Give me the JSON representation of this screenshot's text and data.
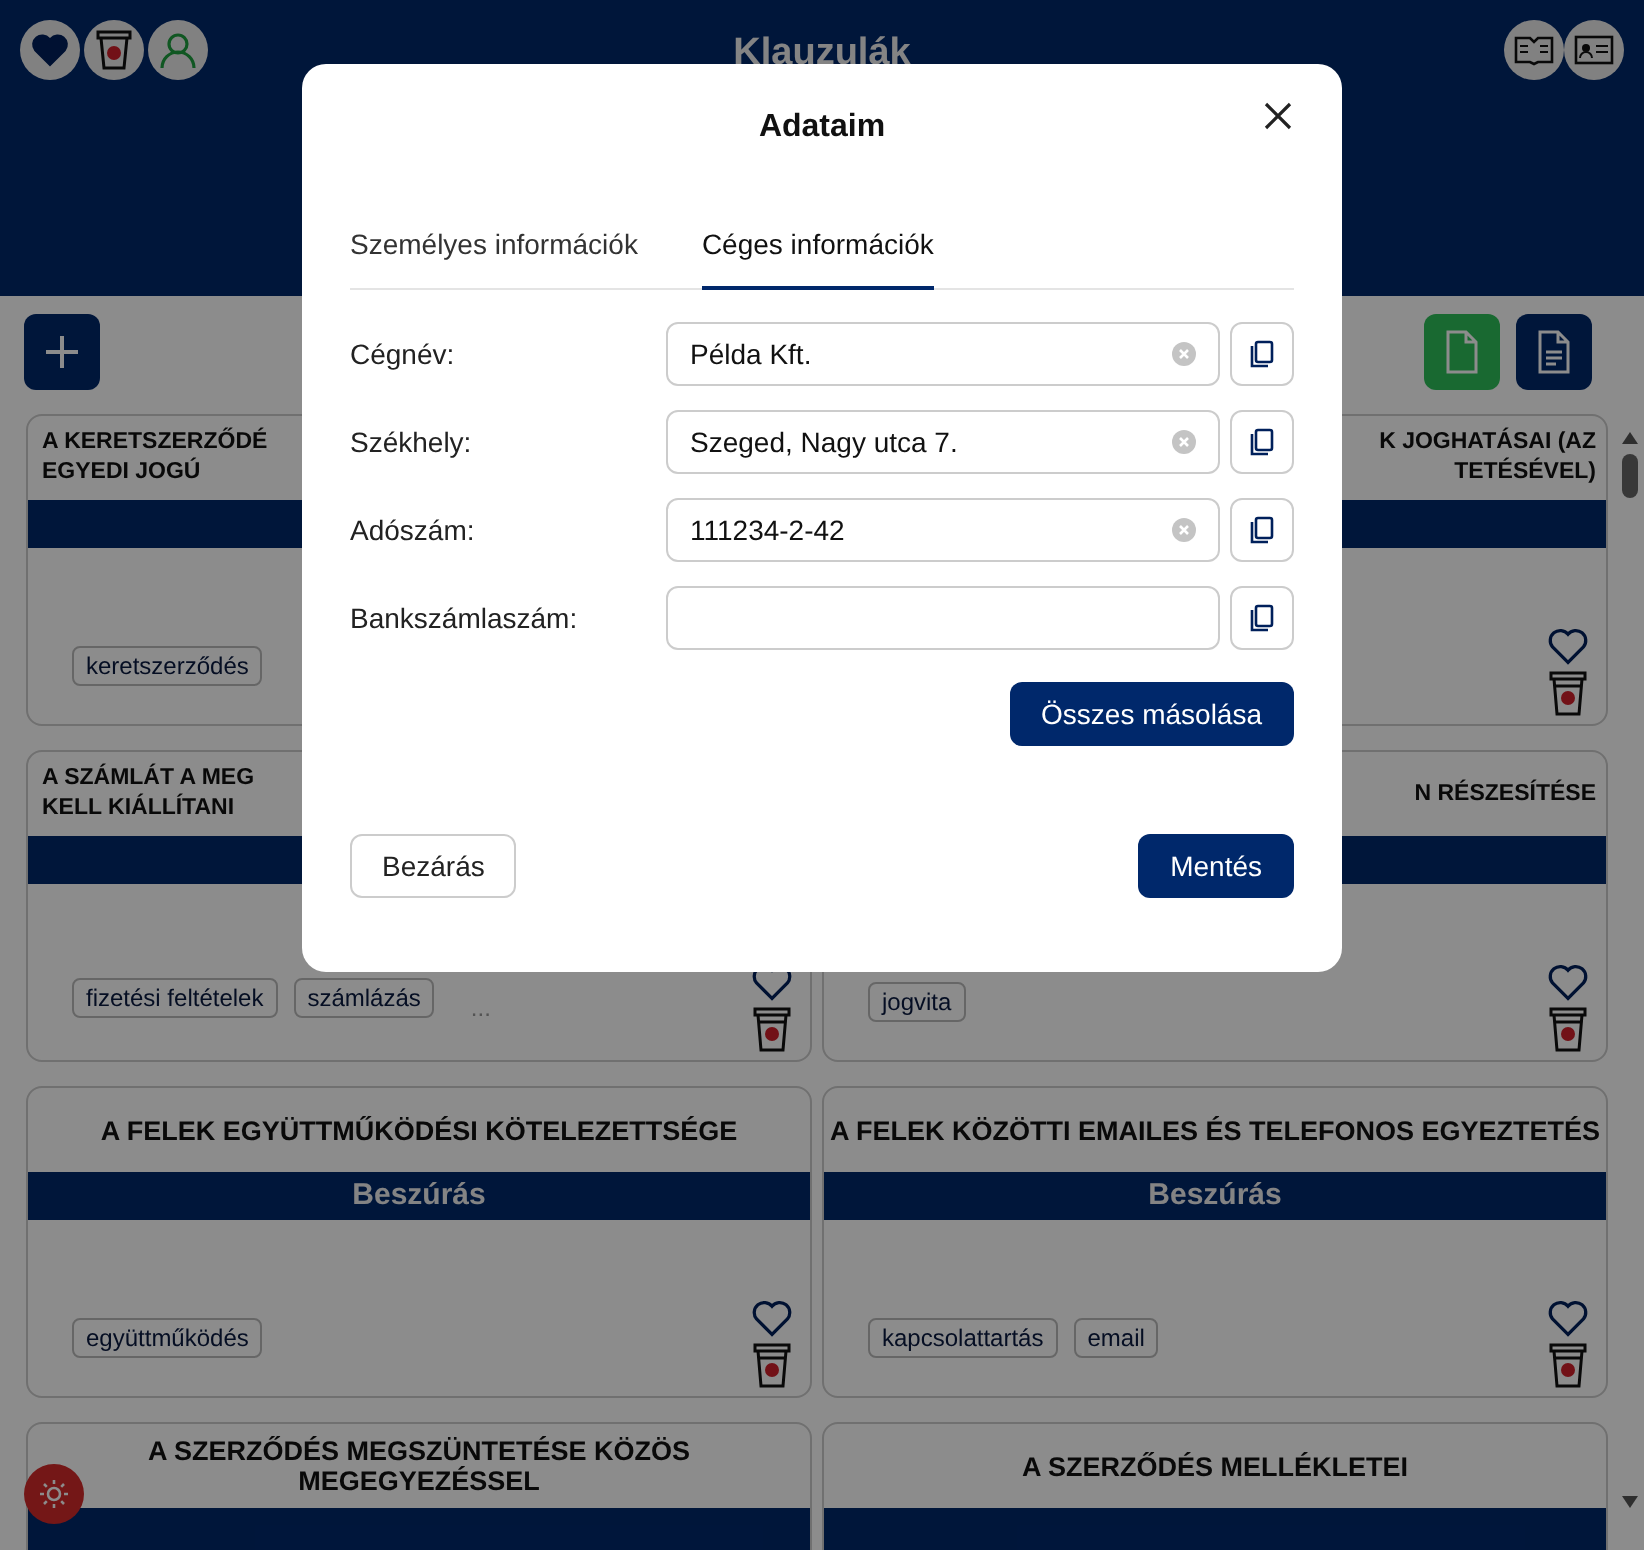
{
  "header": {
    "title": "Klauzulák"
  },
  "cards": [
    {
      "kind": "partial",
      "title_lines": [
        "A KERETSZERZŐDÉ",
        "EGYEDI JOGÚ"
      ],
      "tags": [
        "keretszerződés"
      ]
    },
    {
      "kind": "partial",
      "title_lines": [
        "K JOGHATÁSAI (AZ",
        "TETÉSÉVEL)"
      ]
    },
    {
      "kind": "partial",
      "title_lines": [
        "A SZÁMLÁT A MEG",
        "KELL KIÁLLÍTANI"
      ],
      "tags": [
        "fizetési feltételek",
        "számlázás"
      ],
      "more": "..."
    },
    {
      "kind": "partial",
      "title_lines": [
        "N RÉSZESÍTÉSE"
      ],
      "tags": [
        "jogvita"
      ]
    },
    {
      "kind": "full",
      "title_lines": [
        "A FELEK EGYÜTTMŰKÖDÉSI KÖTELEZETTSÉGE"
      ],
      "insert_label": "Beszúrás",
      "tags": [
        "együttműködés"
      ]
    },
    {
      "kind": "full",
      "title_lines": [
        "A FELEK KÖZÖTTI EMAILES ÉS TELEFONOS EGYEZTETÉS"
      ],
      "insert_label": "Beszúrás",
      "tags": [
        "kapcsolattartás",
        "email"
      ]
    },
    {
      "kind": "full",
      "title_lines": [
        "A SZERZŐDÉS MEGSZÜNTETÉSE KÖZÖS",
        "MEGEGYEZÉSSEL"
      ]
    },
    {
      "kind": "full",
      "title_lines": [
        "A SZERZŐDÉS MELLÉKLETEI"
      ]
    }
  ],
  "modal": {
    "title": "Adataim",
    "tabs": [
      {
        "label": "Személyes információk",
        "selected": false
      },
      {
        "label": "Céges információk",
        "selected": true
      }
    ],
    "fields": [
      {
        "label": "Cégnév:",
        "value": "Példa Kft."
      },
      {
        "label": "Székhely:",
        "value": "Szeged, Nagy utca 7."
      },
      {
        "label": "Adószám:",
        "value": "111234-2-42"
      },
      {
        "label": "Bankszámlaszám:"
      }
    ],
    "copy_all": "Összes másolása",
    "close_button": "Bezárás",
    "save_button": "Mentés"
  }
}
